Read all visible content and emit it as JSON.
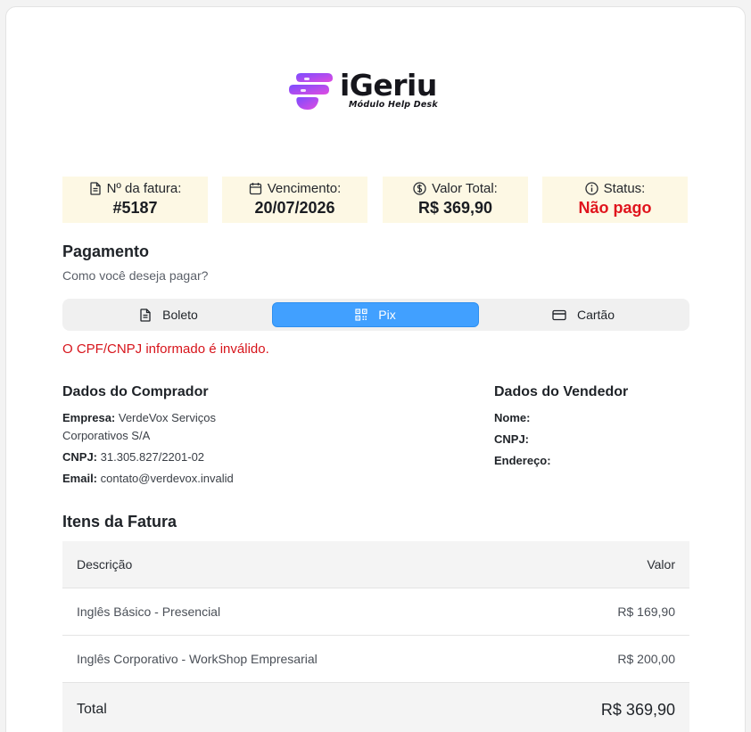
{
  "logo": {
    "name": "iGeriu",
    "subtitle": "Módulo Help Desk"
  },
  "info": {
    "invoice_label": "Nº da fatura:",
    "invoice_value": "#5187",
    "due_label": "Vencimento:",
    "due_value": "20/07/2026",
    "total_label": "Valor Total:",
    "total_value": "R$ 369,90",
    "status_label": "Status:",
    "status_value": "Não pago",
    "status_color": "#e0141d"
  },
  "payment": {
    "title": "Pagamento",
    "question": "Como você deseja pagar?",
    "tabs": [
      {
        "label": "Boleto",
        "icon": "document-icon",
        "active": false
      },
      {
        "label": "Pix",
        "icon": "qr-code-icon",
        "active": true
      },
      {
        "label": "Cartão",
        "icon": "credit-card-icon",
        "active": false
      }
    ],
    "error": "O CPF/CNPJ informado é inválido."
  },
  "buyer": {
    "title": "Dados do Comprador",
    "company_label": "Empresa:",
    "company_value": "VerdeVox Serviços Corporativos S/A",
    "cnpj_label": "CNPJ:",
    "cnpj_value": "31.305.827/2201-02",
    "email_label": "Email:",
    "email_value": "contato@verdevox.invalid"
  },
  "seller": {
    "title": "Dados do Vendedor",
    "name_label": "Nome:",
    "cnpj_label": "CNPJ:",
    "address_label": "Endereço:"
  },
  "items": {
    "title": "Itens da Fatura",
    "headers": {
      "description": "Descrição",
      "value": "Valor"
    },
    "rows": [
      {
        "description": "Inglês Básico - Presencial",
        "value": "R$ 169,90"
      },
      {
        "description": "Inglês Corporativo - WorkShop Empresarial",
        "value": "R$ 200,00"
      }
    ],
    "total_label": "Total",
    "total_value": "R$ 369,90"
  },
  "colors": {
    "accent": "#41a0ff",
    "info_bg": "#fdf8e4",
    "error": "#d7141b",
    "logo_gradient": [
      "#7b4dff",
      "#e04be0"
    ]
  }
}
